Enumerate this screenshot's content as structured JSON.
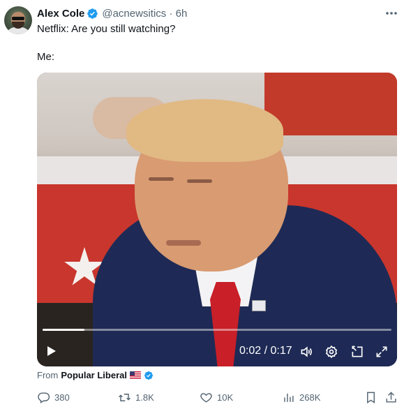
{
  "tweet": {
    "author_name": "Alex Cole",
    "handle": "@acnewsitics",
    "separator": "·",
    "time": "6h",
    "text_line1": "Netflix: Are you still watching?",
    "text_line2": "Me:"
  },
  "video": {
    "current_time": "0:02",
    "divider": "/",
    "duration": "0:17",
    "progress_fraction": 0.12
  },
  "source": {
    "prefix": "From",
    "name": "Popular Liberal"
  },
  "actions": {
    "replies": "380",
    "reposts": "1.8K",
    "likes": "10K",
    "views": "268K"
  },
  "colors": {
    "verified": "#1d9bf0",
    "muted_text": "#536471",
    "primary_text": "#0f1419"
  },
  "icons": [
    "verified-badge-icon",
    "more-icon",
    "play-icon",
    "volume-icon",
    "settings-icon",
    "pip-icon",
    "fullscreen-icon",
    "reply-icon",
    "repost-icon",
    "like-icon",
    "views-icon",
    "bookmark-icon",
    "share-icon",
    "us-flag-icon"
  ]
}
